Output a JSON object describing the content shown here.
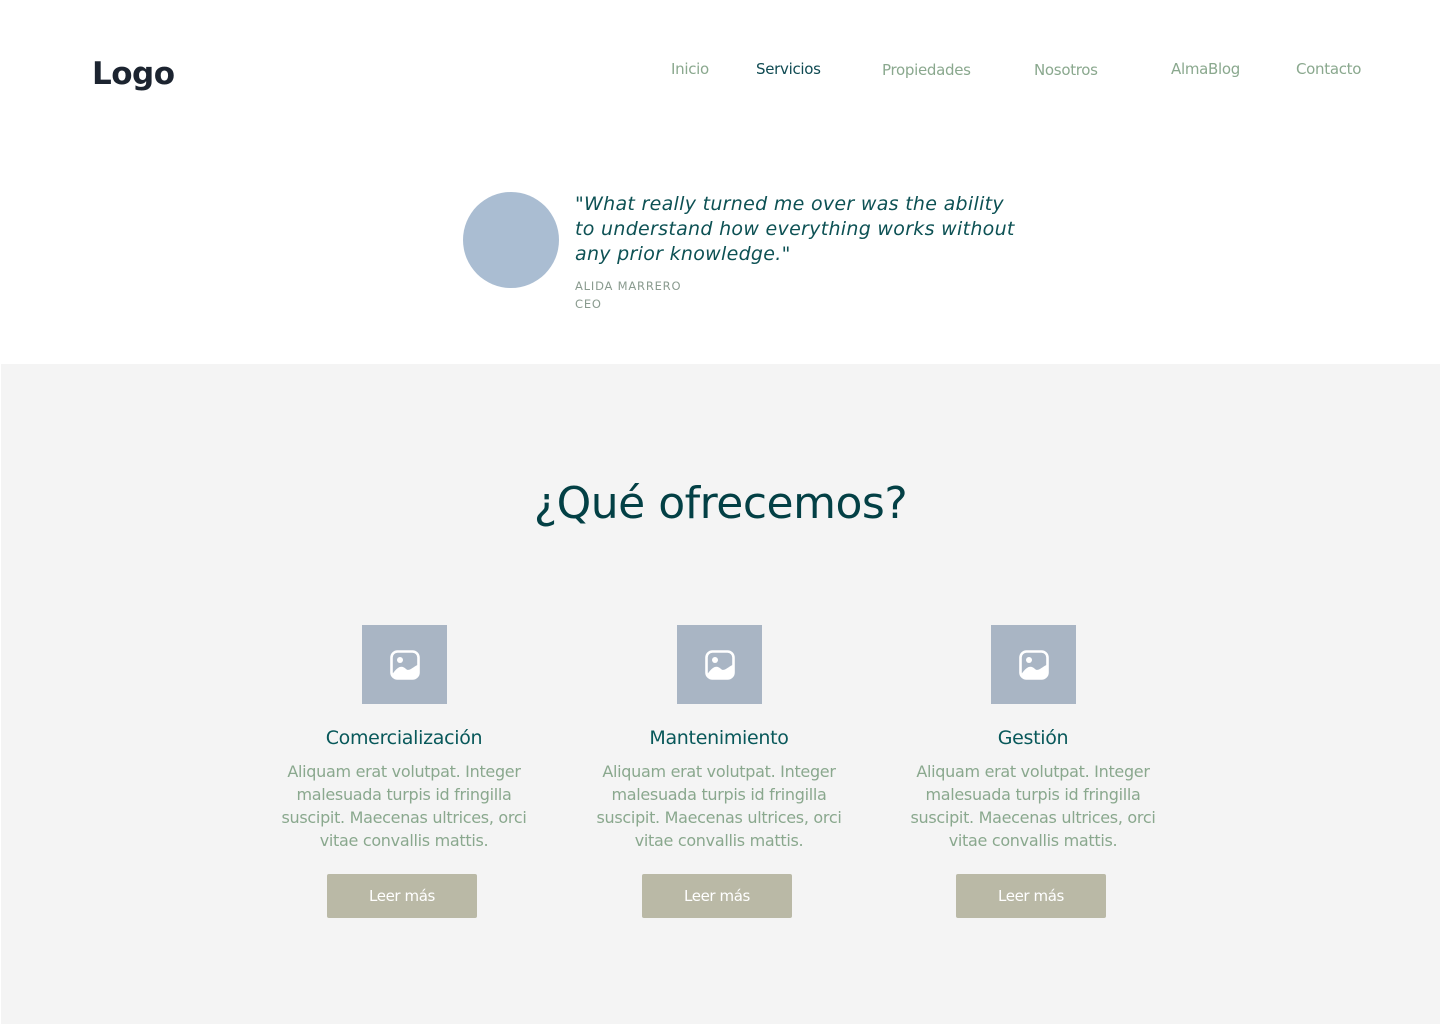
{
  "header": {
    "logo": "Logo",
    "nav": [
      {
        "label": "Inicio",
        "active": false
      },
      {
        "label": "Servicios",
        "active": true
      },
      {
        "label": "Propiedades",
        "active": false
      },
      {
        "label": "Nosotros",
        "active": false
      },
      {
        "label": "AlmaBlog",
        "active": false
      },
      {
        "label": "Contacto",
        "active": false
      }
    ]
  },
  "testimonial": {
    "quote": "\"What really turned me over was the ability to understand how everything works without any prior knowledge.\"",
    "name": "ALIDA MARRERO",
    "role": "CEO"
  },
  "services": {
    "title": "¿Qué ofrecemos?",
    "items": [
      {
        "title": "Comercialización",
        "text": "Aliquam erat volutpat. Integer malesuada turpis id fringilla suscipit. Maecenas ultrices, orci vitae convallis mattis.",
        "button": "Leer más",
        "icon": "image-placeholder-icon"
      },
      {
        "title": "Mantenimiento",
        "text": "Aliquam erat volutpat. Integer malesuada turpis id fringilla suscipit. Maecenas ultrices, orci vitae convallis mattis.",
        "button": "Leer más",
        "icon": "image-placeholder-icon"
      },
      {
        "title": "Gestión",
        "text": "Aliquam erat volutpat. Integer malesuada turpis id fringilla suscipit. Maecenas ultrices, orci vitae convallis mattis.",
        "button": "Leer más",
        "icon": "image-placeholder-icon"
      }
    ]
  },
  "colors": {
    "nav_inactive": "#8aa88e",
    "nav_active": "#0f4a52",
    "heading": "#034045",
    "card_title": "#08585a",
    "body_text": "#8aa88e",
    "quote": "#0d5154",
    "author": "#8a9b8f",
    "avatar": "#aabdd2",
    "image_box": "#a9b5c4",
    "button": "#bab9a6",
    "section_bg": "#f4f4f4"
  }
}
